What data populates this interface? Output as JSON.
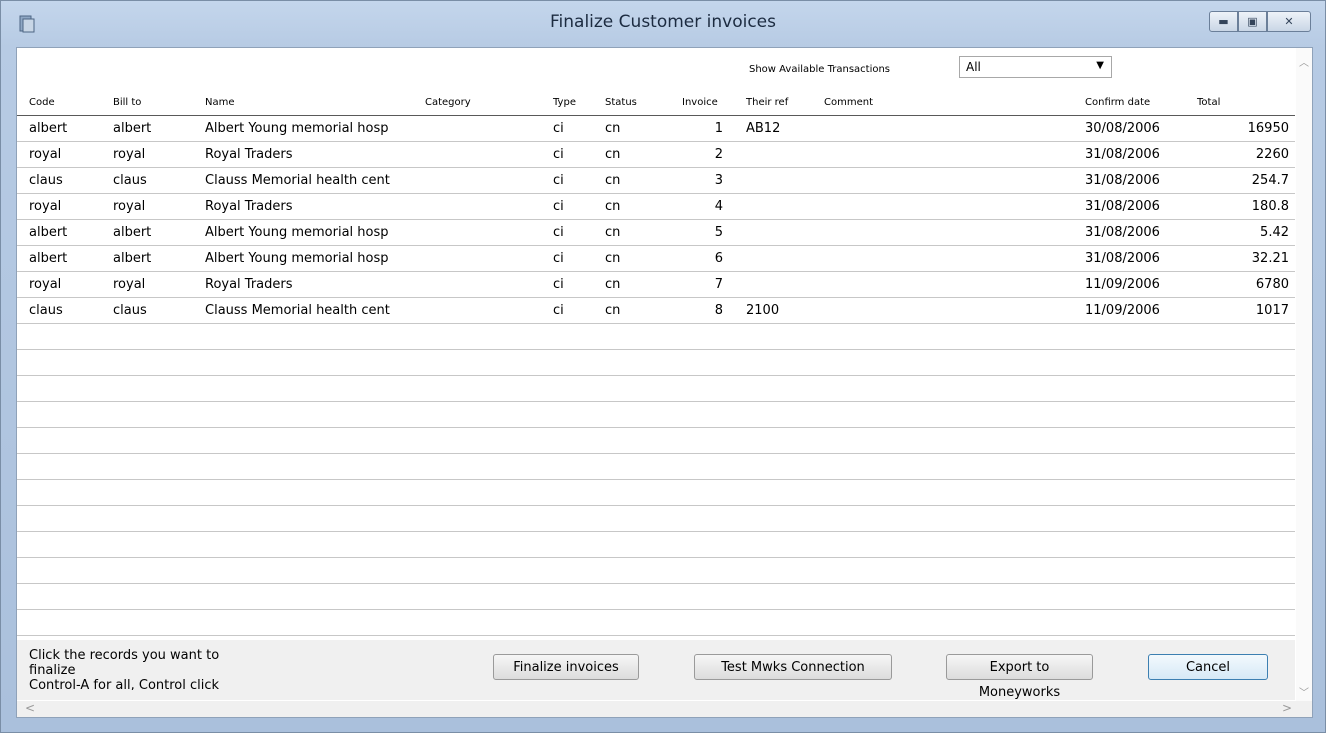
{
  "window": {
    "title": "Finalize Customer invoices"
  },
  "filter": {
    "label": "Show Available Transactions",
    "value": "All"
  },
  "columns": {
    "code": "Code",
    "bill_to": "Bill to",
    "name": "Name",
    "category": "Category",
    "type": "Type",
    "status": "Status",
    "invoice": "Invoice",
    "their_ref": "Their ref",
    "comment": "Comment",
    "confirm_date": "Confirm date",
    "total": "Total"
  },
  "rows": [
    {
      "code": "albert",
      "bill_to": "albert",
      "name": "Albert Young memorial hosp",
      "category": "",
      "type": "ci",
      "status": "cn",
      "invoice": "1",
      "their_ref": "AB12",
      "comment": "",
      "confirm_date": "30/08/2006",
      "total": "16950"
    },
    {
      "code": "royal",
      "bill_to": "royal",
      "name": "Royal Traders",
      "category": "",
      "type": "ci",
      "status": "cn",
      "invoice": "2",
      "their_ref": "",
      "comment": "",
      "confirm_date": "31/08/2006",
      "total": "2260"
    },
    {
      "code": "claus",
      "bill_to": "claus",
      "name": "Clauss Memorial health cent",
      "category": "",
      "type": "ci",
      "status": "cn",
      "invoice": "3",
      "their_ref": "",
      "comment": "",
      "confirm_date": "31/08/2006",
      "total": "254.7"
    },
    {
      "code": "royal",
      "bill_to": "royal",
      "name": "Royal Traders",
      "category": "",
      "type": "ci",
      "status": "cn",
      "invoice": "4",
      "their_ref": "",
      "comment": "",
      "confirm_date": "31/08/2006",
      "total": "180.8"
    },
    {
      "code": "albert",
      "bill_to": "albert",
      "name": "Albert Young memorial hosp",
      "category": "",
      "type": "ci",
      "status": "cn",
      "invoice": "5",
      "their_ref": "",
      "comment": "",
      "confirm_date": "31/08/2006",
      "total": "5.42"
    },
    {
      "code": "albert",
      "bill_to": "albert",
      "name": "Albert Young memorial hosp",
      "category": "",
      "type": "ci",
      "status": "cn",
      "invoice": "6",
      "their_ref": "",
      "comment": "",
      "confirm_date": "31/08/2006",
      "total": "32.21"
    },
    {
      "code": "royal",
      "bill_to": "royal",
      "name": "Royal Traders",
      "category": "",
      "type": "ci",
      "status": "cn",
      "invoice": "7",
      "their_ref": "",
      "comment": "",
      "confirm_date": "11/09/2006",
      "total": "6780"
    },
    {
      "code": "claus",
      "bill_to": "claus",
      "name": "Clauss Memorial health cent",
      "category": "",
      "type": "ci",
      "status": "cn",
      "invoice": "8",
      "their_ref": "2100",
      "comment": "",
      "confirm_date": "11/09/2006",
      "total": "1017"
    }
  ],
  "footer": {
    "hint": "Click the records you want to finalize\nControl-A for all, Control click",
    "buttons": {
      "finalize": "Finalize invoices",
      "test": "Test Mwks Connection",
      "export": "Export to Moneyworks",
      "cancel": "Cancel"
    }
  },
  "icons": {
    "app": "app-document-icon",
    "minimize": "minimize-icon",
    "maximize": "maximize-icon",
    "close": "close-icon",
    "dropdown": "chevron-down-icon"
  }
}
